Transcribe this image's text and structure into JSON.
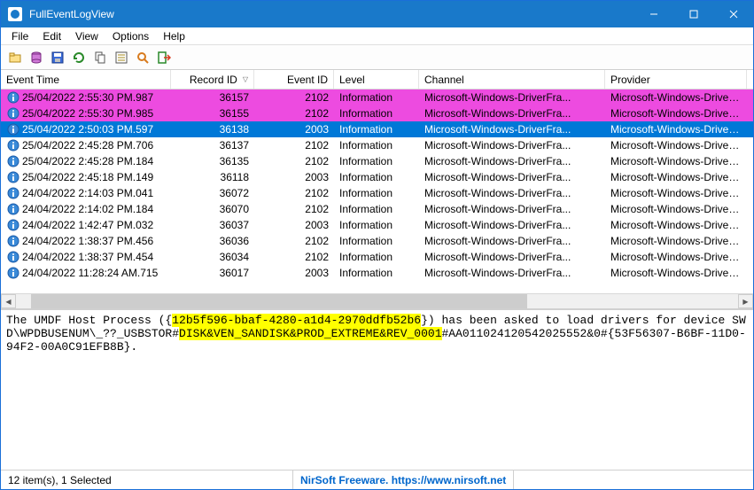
{
  "window": {
    "title": "FullEventLogView"
  },
  "menu": [
    "File",
    "Edit",
    "View",
    "Options",
    "Help"
  ],
  "columns": {
    "event_time": "Event Time",
    "record_id": "Record ID",
    "event_id": "Event ID",
    "level": "Level",
    "channel": "Channel",
    "provider": "Provider",
    "sort_indicator": "▽"
  },
  "rows": [
    {
      "time": "25/04/2022 2:55:30 PM.987",
      "record": "36157",
      "event": "2102",
      "level": "Information",
      "channel": "Microsoft-Windows-DriverFra...",
      "provider": "Microsoft-Windows-DriverFra...",
      "style": "highlight-pink"
    },
    {
      "time": "25/04/2022 2:55:30 PM.985",
      "record": "36155",
      "event": "2102",
      "level": "Information",
      "channel": "Microsoft-Windows-DriverFra...",
      "provider": "Microsoft-Windows-DriverFra...",
      "style": "highlight-pink"
    },
    {
      "time": "25/04/2022 2:50:03 PM.597",
      "record": "36138",
      "event": "2003",
      "level": "Information",
      "channel": "Microsoft-Windows-DriverFra...",
      "provider": "Microsoft-Windows-DriverFra...",
      "style": "selected"
    },
    {
      "time": "25/04/2022 2:45:28 PM.706",
      "record": "36137",
      "event": "2102",
      "level": "Information",
      "channel": "Microsoft-Windows-DriverFra...",
      "provider": "Microsoft-Windows-DriverFra...",
      "style": ""
    },
    {
      "time": "25/04/2022 2:45:28 PM.184",
      "record": "36135",
      "event": "2102",
      "level": "Information",
      "channel": "Microsoft-Windows-DriverFra...",
      "provider": "Microsoft-Windows-DriverFra...",
      "style": ""
    },
    {
      "time": "25/04/2022 2:45:18 PM.149",
      "record": "36118",
      "event": "2003",
      "level": "Information",
      "channel": "Microsoft-Windows-DriverFra...",
      "provider": "Microsoft-Windows-DriverFra...",
      "style": ""
    },
    {
      "time": "24/04/2022 2:14:03 PM.041",
      "record": "36072",
      "event": "2102",
      "level": "Information",
      "channel": "Microsoft-Windows-DriverFra...",
      "provider": "Microsoft-Windows-DriverFra...",
      "style": ""
    },
    {
      "time": "24/04/2022 2:14:02 PM.184",
      "record": "36070",
      "event": "2102",
      "level": "Information",
      "channel": "Microsoft-Windows-DriverFra...",
      "provider": "Microsoft-Windows-DriverFra...",
      "style": ""
    },
    {
      "time": "24/04/2022 1:42:47 PM.032",
      "record": "36037",
      "event": "2003",
      "level": "Information",
      "channel": "Microsoft-Windows-DriverFra...",
      "provider": "Microsoft-Windows-DriverFra...",
      "style": ""
    },
    {
      "time": "24/04/2022 1:38:37 PM.456",
      "record": "36036",
      "event": "2102",
      "level": "Information",
      "channel": "Microsoft-Windows-DriverFra...",
      "provider": "Microsoft-Windows-DriverFra...",
      "style": ""
    },
    {
      "time": "24/04/2022 1:38:37 PM.454",
      "record": "36034",
      "event": "2102",
      "level": "Information",
      "channel": "Microsoft-Windows-DriverFra...",
      "provider": "Microsoft-Windows-DriverFra...",
      "style": ""
    },
    {
      "time": "24/04/2022 11:28:24 AM.715",
      "record": "36017",
      "event": "2003",
      "level": "Information",
      "channel": "Microsoft-Windows-DriverFra...",
      "provider": "Microsoft-Windows-DriverFra...",
      "style": ""
    }
  ],
  "detail": {
    "pre1": "The UMDF Host Process ({",
    "hl1": "12b5f596-bbaf-4280-a1d4-2970ddfb52b6",
    "mid1": "}) has been asked to load drivers for device SWD\\WPDBUSENUM\\_??_USBSTOR#",
    "hl2": "DISK&VEN_SANDISK&PROD_EXTREME&REV_0001",
    "post1": "#AA011024120542025552&0#{53F56307-B6BF-11D0-94F2-00A0C91EFB8B}."
  },
  "status": {
    "count": "12 item(s), 1 Selected",
    "credit": "NirSoft Freeware. https://www.nirsoft.net"
  }
}
